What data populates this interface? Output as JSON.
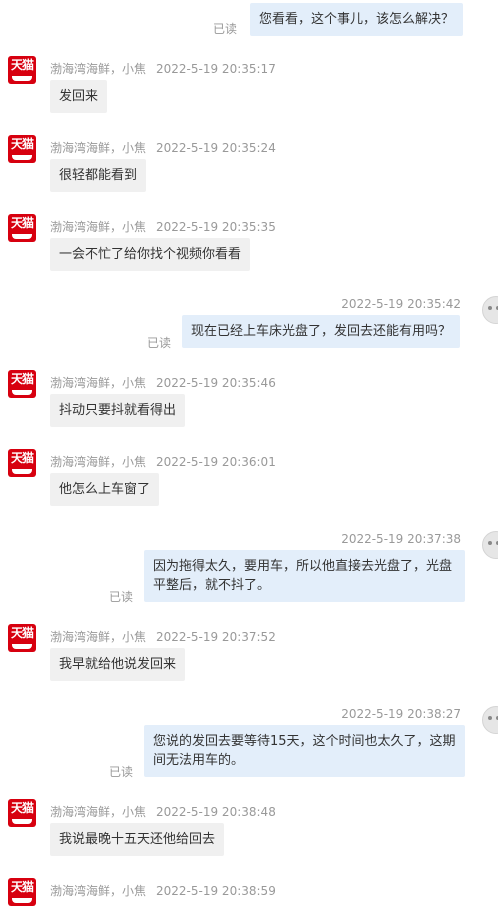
{
  "store_avatar_text": "天猫",
  "read_label": "已读",
  "messages": [
    {
      "side": "out",
      "text": "您看看，这个事儿，该怎么解决？"
    },
    {
      "side": "in",
      "sender": "渤海湾海鲜，小焦",
      "time": "2022-5-19 20:35:17",
      "text": "发回来"
    },
    {
      "side": "in",
      "sender": "渤海湾海鲜，小焦",
      "time": "2022-5-19 20:35:24",
      "text": "很轻都能看到"
    },
    {
      "side": "in",
      "sender": "渤海湾海鲜，小焦",
      "time": "2022-5-19 20:35:35",
      "text": "一会不忙了给你找个视频你看看"
    },
    {
      "side": "out",
      "time": "2022-5-19 20:35:42",
      "text": "现在已经上车床光盘了，发回去还能有用吗？"
    },
    {
      "side": "in",
      "sender": "渤海湾海鲜，小焦",
      "time": "2022-5-19 20:35:46",
      "text": "抖动只要抖就看得出"
    },
    {
      "side": "in",
      "sender": "渤海湾海鲜，小焦",
      "time": "2022-5-19 20:36:01",
      "text": "他怎么上车窗了"
    },
    {
      "side": "out",
      "time": "2022-5-19 20:37:38",
      "text": "因为拖得太久，要用车，所以他直接去光盘了，光盘平整后，就不抖了。"
    },
    {
      "side": "in",
      "sender": "渤海湾海鲜，小焦",
      "time": "2022-5-19 20:37:52",
      "text": "我早就给他说发回来"
    },
    {
      "side": "out",
      "time": "2022-5-19 20:38:27",
      "text": "您说的发回去要等待15天，这个时间也太久了，这期间无法用车的。"
    },
    {
      "side": "in",
      "sender": "渤海湾海鲜，小焦",
      "time": "2022-5-19 20:38:48",
      "text": "我说最晚十五天还他给回去"
    },
    {
      "side": "in",
      "sender": "渤海湾海鲜，小焦",
      "time": "2022-5-19 20:38:59",
      "text": ""
    }
  ]
}
